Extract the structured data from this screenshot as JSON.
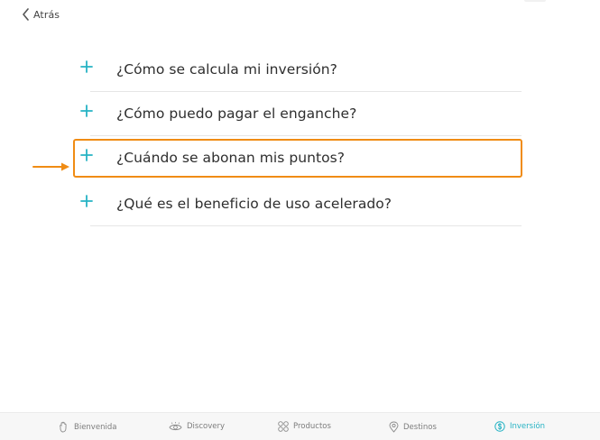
{
  "topbar": {
    "back_label": "Atrás",
    "back_icon": "chevron-left-icon"
  },
  "faq": {
    "items": [
      {
        "question": "¿Cómo se calcula mi inversión?",
        "icon": "plus-icon"
      },
      {
        "question": "¿Cómo puedo pagar el enganche?",
        "icon": "plus-icon"
      },
      {
        "question": "¿Cuándo se abonan mis puntos?",
        "icon": "plus-icon",
        "highlighted": true
      },
      {
        "question": "¿Qué es el beneficio de uso acelerado?",
        "icon": "plus-icon"
      }
    ]
  },
  "colors": {
    "accent": "#26b3c4",
    "highlight": "#f08c14",
    "tab_inactive": "#7d7d7d"
  },
  "tabbar": {
    "tabs": [
      {
        "label": "Bienvenida",
        "icon": "hand-wave-icon",
        "active": false
      },
      {
        "label": "Discovery",
        "icon": "eye-icon",
        "active": false
      },
      {
        "label": "Productos",
        "icon": "grid-icon",
        "active": false
      },
      {
        "label": "Destinos",
        "icon": "map-pin-icon",
        "active": false
      },
      {
        "label": "Inversión",
        "icon": "dollar-circle-icon",
        "active": true
      }
    ]
  }
}
